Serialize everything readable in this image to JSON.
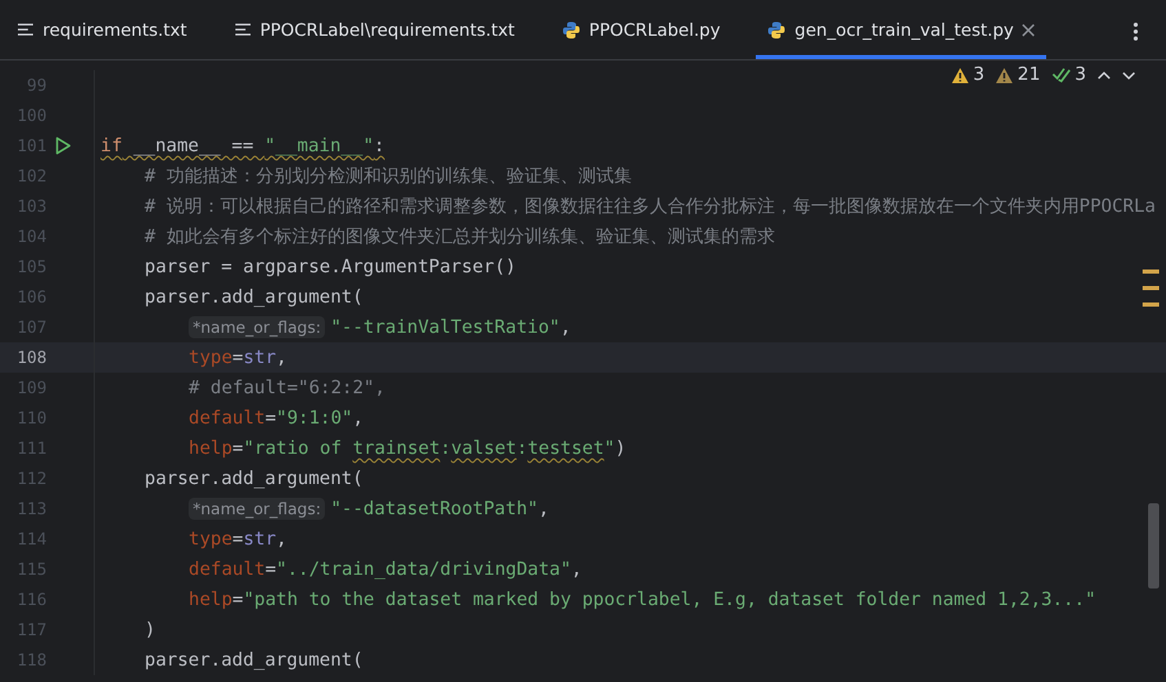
{
  "tabs": [
    {
      "label": "requirements.txt",
      "kind": "text",
      "selected": false
    },
    {
      "label": "PPOCRLabel\\requirements.txt",
      "kind": "text",
      "selected": false
    },
    {
      "label": "PPOCRLabel.py",
      "kind": "python",
      "selected": false
    },
    {
      "label": "gen_ocr_train_val_test.py",
      "kind": "python",
      "selected": true
    }
  ],
  "inspections": [
    {
      "kind": "warning",
      "count": "3"
    },
    {
      "kind": "weak-warning",
      "count": "21"
    },
    {
      "kind": "typo",
      "count": "3"
    }
  ],
  "lines": [
    {
      "number": "99",
      "current": false,
      "runnable": false
    },
    {
      "number": "100",
      "current": false,
      "runnable": false
    },
    {
      "number": "101",
      "current": false,
      "runnable": true,
      "tokens": [
        {
          "kind": "keyword",
          "text": "if",
          "squiggle": true
        },
        {
          "kind": "plain",
          "text": " __name__ == ",
          "squiggle": true
        },
        {
          "kind": "string",
          "text": "\"__main__\"",
          "squiggle": true
        },
        {
          "kind": "plain",
          "text": ":",
          "squiggle": true
        }
      ],
      "children": [
        {
          "number": "102",
          "current": false,
          "runnable": false,
          "tokens": [
            {
              "kind": "comment",
              "text": "# 功能描述：分别划分检测和识别的训练集、验证集、测试集",
              "squiggle": false
            }
          ]
        },
        {
          "number": "103",
          "current": false,
          "runnable": false,
          "tokens": [
            {
              "kind": "comment",
              "text": "# 说明：可以根据自己的路径和需求调整参数，图像数据往往多人合作分批标注，每一批图像数据放在一个文件夹内用PPOCRLa",
              "squiggle": false
            }
          ]
        },
        {
          "number": "104",
          "current": false,
          "runnable": false,
          "tokens": [
            {
              "kind": "comment",
              "text": "# 如此会有多个标注好的图像文件夹汇总并划分训练集、验证集、测试集的需求",
              "squiggle": false
            }
          ]
        },
        {
          "number": "105",
          "current": false,
          "runnable": false,
          "tokens": [
            {
              "kind": "plain",
              "text": "parser = argparse.ArgumentParser()",
              "squiggle": false
            }
          ]
        },
        {
          "number": "106",
          "current": false,
          "runnable": false,
          "tokens": [
            {
              "kind": "plain",
              "text": "parser.add_argument(",
              "squiggle": false
            }
          ],
          "children": [
            {
              "number": "107",
              "current": false,
              "runnable": false,
              "hint": "*name_or_flags:",
              "tokens": [
                {
                  "kind": "string",
                  "text": "\"--trainValTestRatio\"",
                  "squiggle": false
                },
                {
                  "kind": "plain",
                  "text": ",",
                  "squiggle": false
                }
              ]
            },
            {
              "number": "108",
              "current": true,
              "runnable": false,
              "tokens": [
                {
                  "kind": "param",
                  "text": "type",
                  "squiggle": false
                },
                {
                  "kind": "plain",
                  "text": "=",
                  "squiggle": false
                },
                {
                  "kind": "builtin",
                  "text": "str",
                  "squiggle": false
                },
                {
                  "kind": "plain",
                  "text": ",",
                  "squiggle": false
                }
              ]
            },
            {
              "number": "109",
              "current": false,
              "runnable": false,
              "tokens": [
                {
                  "kind": "comment",
                  "text": "# default=\"6:2:2\",",
                  "squiggle": false
                }
              ]
            },
            {
              "number": "110",
              "current": false,
              "runnable": false,
              "tokens": [
                {
                  "kind": "param",
                  "text": "default",
                  "squiggle": false
                },
                {
                  "kind": "plain",
                  "text": "=",
                  "squiggle": false
                },
                {
                  "kind": "string",
                  "text": "\"9:1:0\"",
                  "squiggle": false
                },
                {
                  "kind": "plain",
                  "text": ",",
                  "squiggle": false
                }
              ]
            },
            {
              "number": "111",
              "current": false,
              "runnable": false,
              "tokens": [
                {
                  "kind": "param",
                  "text": "help",
                  "squiggle": false
                },
                {
                  "kind": "plain",
                  "text": "=",
                  "squiggle": false
                },
                {
                  "kind": "string",
                  "text": "\"ratio of ",
                  "squiggle": false
                },
                {
                  "kind": "string",
                  "text": "trainset",
                  "squiggle": true
                },
                {
                  "kind": "string",
                  "text": ":",
                  "squiggle": false
                },
                {
                  "kind": "string",
                  "text": "valset",
                  "squiggle": true
                },
                {
                  "kind": "string",
                  "text": ":",
                  "squiggle": false
                },
                {
                  "kind": "string",
                  "text": "testset",
                  "squiggle": true
                },
                {
                  "kind": "string",
                  "text": "\"",
                  "squiggle": false
                },
                {
                  "kind": "plain",
                  "text": ")",
                  "squiggle": false
                }
              ]
            }
          ]
        },
        {
          "number": "112",
          "current": false,
          "runnable": false,
          "tokens": [
            {
              "kind": "plain",
              "text": "parser.add_argument(",
              "squiggle": false
            }
          ],
          "children": [
            {
              "number": "113",
              "current": false,
              "runnable": false,
              "hint": "*name_or_flags:",
              "tokens": [
                {
                  "kind": "string",
                  "text": "\"--datasetRootPath\"",
                  "squiggle": false
                },
                {
                  "kind": "plain",
                  "text": ",",
                  "squiggle": false
                }
              ]
            },
            {
              "number": "114",
              "current": false,
              "runnable": false,
              "tokens": [
                {
                  "kind": "param",
                  "text": "type",
                  "squiggle": false
                },
                {
                  "kind": "plain",
                  "text": "=",
                  "squiggle": false
                },
                {
                  "kind": "builtin",
                  "text": "str",
                  "squiggle": false
                },
                {
                  "kind": "plain",
                  "text": ",",
                  "squiggle": false
                }
              ]
            },
            {
              "number": "115",
              "current": false,
              "runnable": false,
              "tokens": [
                {
                  "kind": "param",
                  "text": "default",
                  "squiggle": false
                },
                {
                  "kind": "plain",
                  "text": "=",
                  "squiggle": false
                },
                {
                  "kind": "string",
                  "text": "\"../train_data/drivingData\"",
                  "squiggle": false
                },
                {
                  "kind": "plain",
                  "text": ",",
                  "squiggle": false
                }
              ]
            },
            {
              "number": "116",
              "current": false,
              "runnable": false,
              "tokens": [
                {
                  "kind": "param",
                  "text": "help",
                  "squiggle": false
                },
                {
                  "kind": "plain",
                  "text": "=",
                  "squiggle": false
                },
                {
                  "kind": "string",
                  "text": "\"path to the dataset marked by ppocrlabel, E.g, dataset folder named 1,2,3...\"",
                  "squiggle": false
                }
              ]
            }
          ]
        },
        {
          "number": "117",
          "current": false,
          "runnable": false,
          "tokens": [
            {
              "kind": "plain",
              "text": ")",
              "squiggle": false
            }
          ]
        },
        {
          "number": "118",
          "current": false,
          "runnable": false,
          "tokens": [
            {
              "kind": "plain",
              "text": "parser.add_argument(",
              "squiggle": false
            }
          ]
        }
      ]
    }
  ]
}
